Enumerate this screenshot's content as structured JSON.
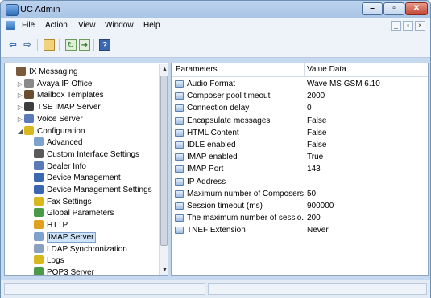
{
  "window": {
    "title": "UC Admin"
  },
  "menu": {
    "items": [
      "File",
      "Action",
      "View",
      "Window",
      "Help"
    ]
  },
  "tree": {
    "items": [
      {
        "label": "IX Messaging",
        "icon": "messaging-icon",
        "expander": "",
        "color": "#7a5a3a"
      },
      {
        "label": "Avaya IP Office",
        "icon": "ipoffice-icon",
        "expander": "▷",
        "color": "#8a8a8a"
      },
      {
        "label": "Mailbox Templates",
        "icon": "mailbox-templates-icon",
        "expander": "▷",
        "color": "#6b4e2e"
      },
      {
        "label": "TSE IMAP Server",
        "icon": "tse-imap-server-icon",
        "expander": "▷",
        "color": "#3d3d3d"
      },
      {
        "label": "Voice Server",
        "icon": "voice-server-icon",
        "expander": "▷",
        "color": "#5a7ab8"
      },
      {
        "label": "Configuration",
        "icon": "configuration-icon",
        "expander": "◢",
        "color": "#d8b81e"
      },
      {
        "label": "Advanced",
        "icon": "advanced-icon",
        "expander": "",
        "color": "#7da2ce"
      },
      {
        "label": "Custom Interface Settings",
        "icon": "custom-interface-icon",
        "expander": "",
        "color": "#5a5a5a"
      },
      {
        "label": "Dealer Info",
        "icon": "dealer-info-icon",
        "expander": "",
        "color": "#5a7ab8"
      },
      {
        "label": "Device Management",
        "icon": "device-management-icon",
        "expander": "",
        "color": "#3b67b0"
      },
      {
        "label": "Device Management Settings",
        "icon": "device-management-settings-icon",
        "expander": "",
        "color": "#3b67b0"
      },
      {
        "label": "Fax Settings",
        "icon": "fax-settings-icon",
        "expander": "",
        "color": "#d8b81e"
      },
      {
        "label": "Global Parameters",
        "icon": "global-parameters-icon",
        "expander": "",
        "color": "#4a9a4a"
      },
      {
        "label": "HTTP",
        "icon": "http-icon",
        "expander": "",
        "color": "#e0a020"
      },
      {
        "label": "IMAP Server",
        "icon": "imap-server-icon",
        "expander": "",
        "color": "#7da2ce"
      },
      {
        "label": "LDAP Synchronization",
        "icon": "ldap-sync-icon",
        "expander": "",
        "color": "#8aa0bf"
      },
      {
        "label": "Logs",
        "icon": "logs-icon",
        "expander": "",
        "color": "#d8b81e"
      },
      {
        "label": "POP3 Server",
        "icon": "pop3-server-icon",
        "expander": "",
        "color": "#4a9a4a"
      }
    ],
    "selected": "IMAP Server"
  },
  "grid": {
    "headers": {
      "name": "Parameters",
      "value": "Value Data"
    },
    "rows": [
      {
        "name": "Audio Format",
        "value": "Wave MS GSM 6.10"
      },
      {
        "name": "Composer pool timeout",
        "value": "2000"
      },
      {
        "name": "Connection delay",
        "value": "0"
      },
      {
        "name": "Encapsulate messages",
        "value": "False"
      },
      {
        "name": "HTML Content",
        "value": "False"
      },
      {
        "name": "IDLE enabled",
        "value": "False"
      },
      {
        "name": "IMAP enabled",
        "value": "True"
      },
      {
        "name": "IMAP Port",
        "value": "143"
      },
      {
        "name": "IP Address",
        "value": ""
      },
      {
        "name": "Maximum number of Composers",
        "value": "50"
      },
      {
        "name": "Session timeout (ms)",
        "value": "900000"
      },
      {
        "name": "The maximum number of sessio...",
        "value": "200"
      },
      {
        "name": "TNEF Extension",
        "value": "Never"
      }
    ]
  },
  "colors": {
    "titlebar": "#bcd3ee",
    "selection": "#cfe3fa",
    "close_button": "#c44632"
  }
}
